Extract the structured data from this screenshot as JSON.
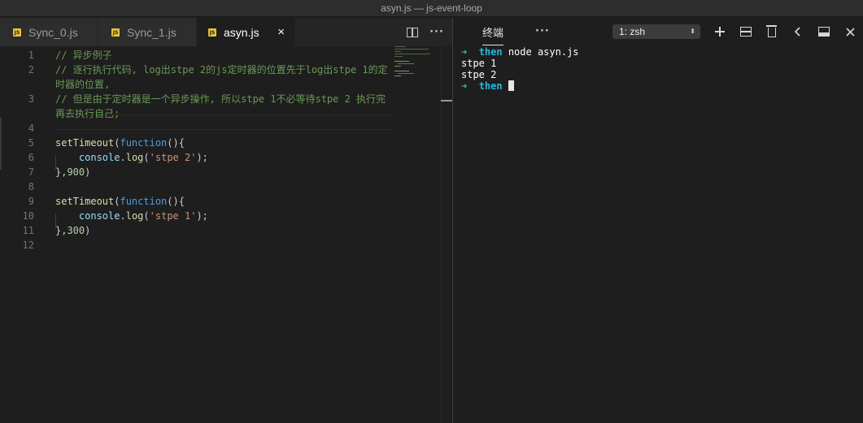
{
  "window": {
    "title": "asyn.js — js-event-loop"
  },
  "tabs": [
    {
      "label": "Sync_0.js",
      "icon": "js-file-icon",
      "icon_text": "JS"
    },
    {
      "label": "Sync_1.js",
      "icon": "js-file-icon",
      "icon_text": "JS"
    },
    {
      "label": "asyn.js",
      "icon": "js-file-icon",
      "icon_text": "JS",
      "active": true,
      "close": "×"
    }
  ],
  "editor": {
    "more_label": "···",
    "lines": [
      {
        "num": "1",
        "tokens": [
          [
            "c-comment",
            "// 异步例子"
          ]
        ]
      },
      {
        "num": "2",
        "tokens": [
          [
            "c-comment",
            "// 逐行执行代码, log出stpe 2的js定时器的位置先于log出stpe 1的定"
          ]
        ]
      },
      {
        "num": "",
        "tokens": [
          [
            "c-comment",
            "时器的位置,"
          ]
        ]
      },
      {
        "num": "3",
        "tokens": [
          [
            "c-comment",
            "// 但是由于定时器是一个异步操作, 所以stpe 1不必等待stpe 2 执行完"
          ]
        ]
      },
      {
        "num": "",
        "tokens": [
          [
            "c-comment",
            "再去执行自己;"
          ]
        ]
      },
      {
        "num": "4",
        "tokens": []
      },
      {
        "num": "5",
        "tokens": [
          [
            "c-fn",
            "setTimeout"
          ],
          [
            "",
            "("
          ],
          [
            "c-kw",
            "function"
          ],
          [
            "",
            "(){"
          ]
        ]
      },
      {
        "num": "6",
        "tokens": [
          [
            "",
            "    "
          ],
          [
            "c-prop",
            "console"
          ],
          [
            "",
            "."
          ],
          [
            "c-fn",
            "log"
          ],
          [
            "",
            "("
          ],
          [
            "c-str",
            "'stpe 2'"
          ],
          [
            "",
            ");"
          ]
        ]
      },
      {
        "num": "7",
        "tokens": [
          [
            "",
            "},"
          ],
          [
            "c-num",
            "900"
          ],
          [
            "",
            ")"
          ]
        ]
      },
      {
        "num": "8",
        "tokens": []
      },
      {
        "num": "9",
        "tokens": [
          [
            "c-fn",
            "setTimeout"
          ],
          [
            "",
            "("
          ],
          [
            "c-kw",
            "function"
          ],
          [
            "",
            "(){"
          ]
        ]
      },
      {
        "num": "10",
        "tokens": [
          [
            "",
            "    "
          ],
          [
            "c-prop",
            "console"
          ],
          [
            "",
            "."
          ],
          [
            "c-fn",
            "log"
          ],
          [
            "",
            "("
          ],
          [
            "c-str",
            "'stpe 1'"
          ],
          [
            "",
            ");"
          ]
        ]
      },
      {
        "num": "11",
        "tokens": [
          [
            "",
            "},"
          ],
          [
            "c-num",
            "300"
          ],
          [
            "",
            ")"
          ]
        ]
      },
      {
        "num": "12",
        "tokens": []
      }
    ]
  },
  "panel": {
    "tab_label": "终端",
    "more_label": "···",
    "terminal_select": "1: zsh",
    "select_arrow": "⬍",
    "actions": [
      "add-terminal",
      "split-terminal",
      "kill-terminal",
      "collapse",
      "maximize-panel",
      "close-panel"
    ],
    "terminal_lines": [
      {
        "prompt": "➜",
        "dir": "then",
        "cmd": " node asyn.js"
      },
      {
        "text": "stpe 1"
      },
      {
        "text": "stpe 2"
      },
      {
        "prompt": "➜",
        "dir": "then",
        "cmd": " ",
        "cursor": true
      }
    ]
  },
  "colors": {
    "comment": "#6a9955",
    "keyword": "#569cd6",
    "function": "#dcdcaa",
    "string": "#ce9178",
    "number": "#b5cea8",
    "prompt_arrow": "#23d18b",
    "prompt_dir": "#29b8db",
    "js_icon": "#e8c33a"
  }
}
